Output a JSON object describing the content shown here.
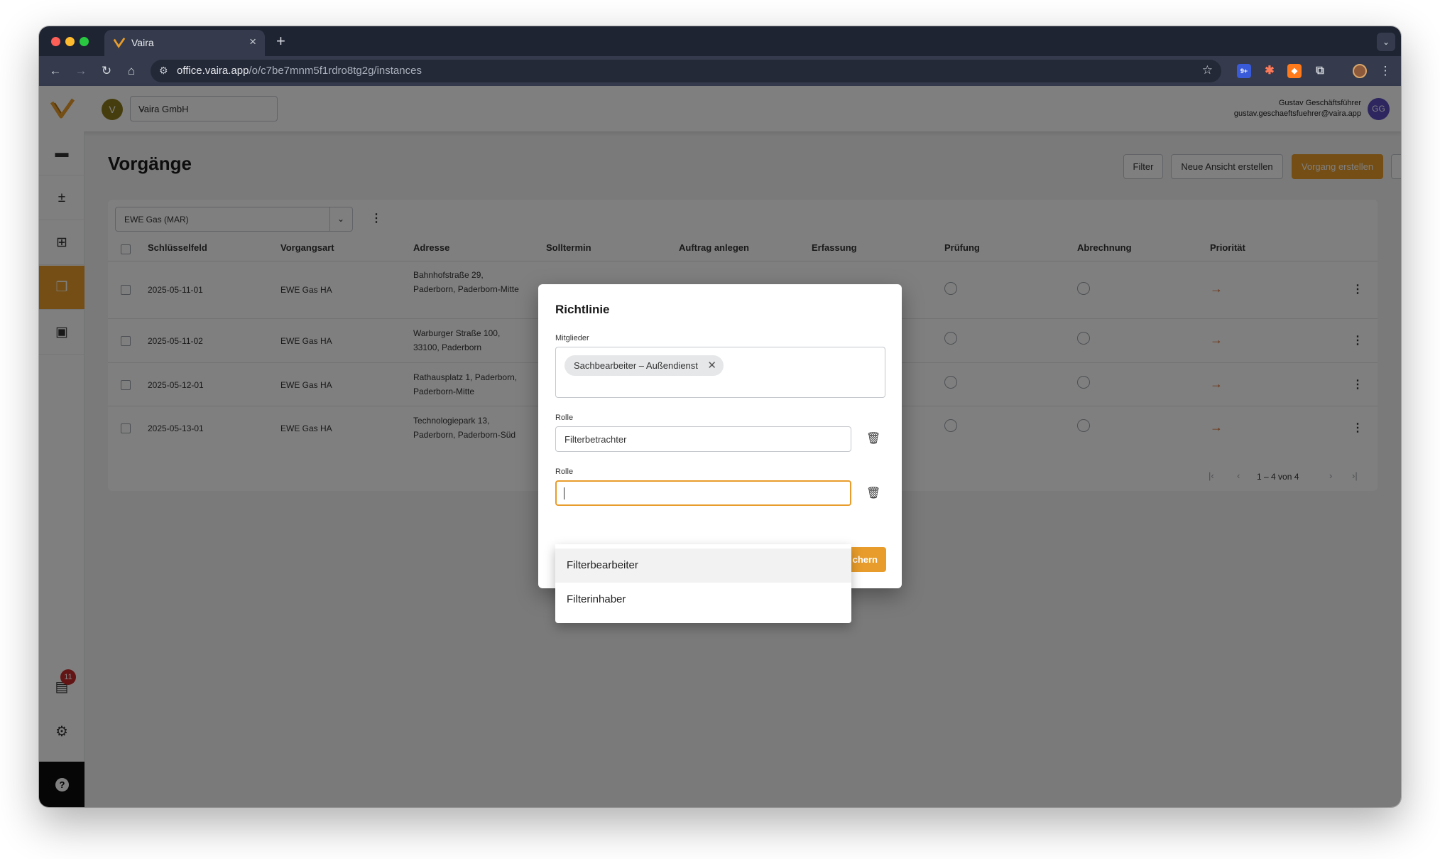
{
  "browser": {
    "tab_title": "Vaira",
    "url_host": "office.vaira.app",
    "url_path": "/o/c7be7mnm5f1rdro8tg2g/instances",
    "new_tab_label": "+",
    "extension_badge": "9+"
  },
  "header": {
    "org_badge": "V",
    "org_name": "Vaira GmbH",
    "user_name": "Gustav Geschäftsführer",
    "user_email": "gustav.geschaeftsfuehrer@vaira.app",
    "user_initials": "GG"
  },
  "sidebar": {
    "inbox_badge": "11",
    "help_label": "?"
  },
  "page": {
    "title": "Vorgänge",
    "filter_btn": "Filter",
    "new_view_btn": "Neue Ansicht erstellen",
    "create_btn": "Vorgang erstellen",
    "view_select": "EWE Gas (MAR)"
  },
  "table": {
    "columns": [
      "Schlüsselfeld",
      "Vorgangsart",
      "Adresse",
      "Solltermin",
      "Auftrag anlegen",
      "Erfassung",
      "Prüfung",
      "Abrechnung",
      "Priorität"
    ],
    "rows": [
      {
        "key": "2025-05-11-01",
        "type": "EWE Gas HA",
        "address": "Bahnhofstraße 29, Paderborn, Paderborn-Mitte",
        "priority": "→"
      },
      {
        "key": "2025-05-11-02",
        "type": "EWE Gas HA",
        "address": "Warburger Straße 100, 33100, Paderborn",
        "priority": "→"
      },
      {
        "key": "2025-05-12-01",
        "type": "EWE Gas HA",
        "address": "Rathausplatz 1, Paderborn, Paderborn-Mitte",
        "priority": "→"
      },
      {
        "key": "2025-05-13-01",
        "type": "EWE Gas HA",
        "address": "Technologiepark 13, Paderborn, Paderborn-Süd",
        "priority": "→"
      }
    ],
    "pagination": "1 – 4 von 4"
  },
  "dialog": {
    "title": "Richtlinie",
    "members_label": "Mitglieder",
    "member_chip": "Sachbearbeiter – Außendienst",
    "role_label_1": "Rolle",
    "role_value_1": "Filterbetrachter",
    "role_label_2": "Rolle",
    "role_value_2": "",
    "save_btn_partial": "chern",
    "dropdown_options": [
      "Filterbearbeiter",
      "Filterinhaber"
    ]
  },
  "colors": {
    "accent": "#e89c2b",
    "priority": "#d9692b",
    "avatar": "#5a4dbf"
  }
}
